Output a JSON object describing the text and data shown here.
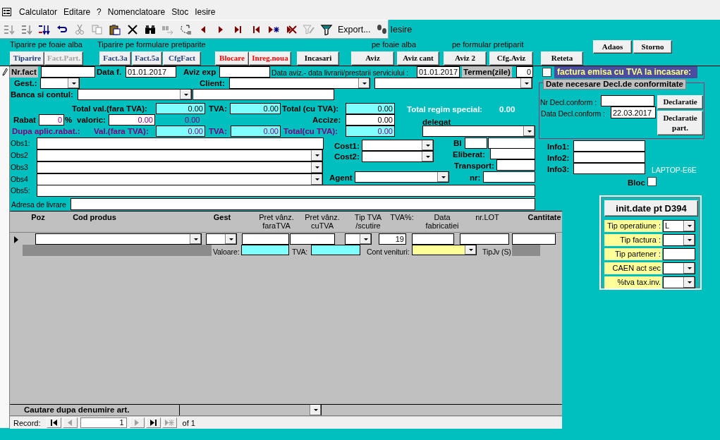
{
  "menu": [
    {
      "label": "Calculator"
    },
    {
      "label": "Editare"
    },
    {
      "label": "?"
    },
    {
      "label": "Nomenclatoare"
    },
    {
      "label": "Stoc"
    },
    {
      "label": "Iesire"
    }
  ],
  "toolbar": {
    "export_label": "Export...",
    "exit_label": "Iesire"
  },
  "button_bar": {
    "captions": [
      "Tiparire pe foaie alba",
      "Tiparire pe formulare pretiparite",
      "pe foaie alba",
      "pe formular pretiparit"
    ],
    "buttons": [
      {
        "label": "Tiparire",
        "color": "#1f3f7f",
        "disabled": false
      },
      {
        "label": "Fact.Part.",
        "disabled": true
      },
      {
        "label": "Fact.3a",
        "color": "#1f3f7f",
        "disabled": false
      },
      {
        "label": "Fact.5a",
        "color": "#1f3f7f",
        "disabled": false
      },
      {
        "label": "CfgFact",
        "color": "#1f3f7f",
        "disabled": false
      },
      {
        "label": "Blocare",
        "color": "#ff0000",
        "disabled": false
      },
      {
        "label": "Inreg.noua",
        "color": "#ff0000",
        "disabled": false
      },
      {
        "label": "Incasari",
        "color": "#000000",
        "disabled": false
      },
      {
        "label": "Aviz",
        "color": "#000000",
        "disabled": false
      },
      {
        "label": "Aviz cant",
        "color": "#000000",
        "disabled": false
      },
      {
        "label": "Aviz 2",
        "color": "#000000",
        "disabled": false
      },
      {
        "label": "Cfg.Aviz",
        "color": "#000000",
        "disabled": false
      },
      {
        "label": "Reteta",
        "color": "#000000",
        "disabled": false
      },
      {
        "label": "Adaos",
        "color": "#000000",
        "disabled": false
      },
      {
        "label": "Storno",
        "color": "#000000",
        "disabled": false
      }
    ]
  },
  "form": {
    "controls": [
      {
        "kind": "label",
        "text": "Nr.fact",
        "shaded": true
      },
      {
        "kind": "field"
      },
      {
        "kind": "label",
        "text": "Data f."
      },
      {
        "kind": "field",
        "value": "01.01.2017"
      },
      {
        "kind": "label",
        "text": "Aviz exp"
      },
      {
        "kind": "field"
      },
      {
        "kind": "caption",
        "text": "Data aviz.- data livrarii/prestarii serviciului :"
      },
      {
        "kind": "field",
        "value": "01.01.2017"
      },
      {
        "kind": "label",
        "text": "Termen(zile)",
        "shaded": true
      },
      {
        "kind": "field",
        "value": "0"
      },
      {
        "kind": "checkbox",
        "checked": false
      },
      {
        "kind": "banner",
        "text": "factura emisa cu TVA la incasare:"
      },
      {
        "kind": "label",
        "text": "Gest.:"
      },
      {
        "kind": "combo"
      },
      {
        "kind": "label",
        "text": "Client:"
      },
      {
        "kind": "combo"
      },
      {
        "kind": "combo"
      },
      {
        "kind": "label",
        "text": "Banca si contul:"
      },
      {
        "kind": "combo"
      },
      {
        "kind": "field"
      },
      {
        "kind": "label",
        "text": "Total val.(fara TVA):"
      },
      {
        "kind": "field",
        "value": "0.00",
        "readonly": true
      },
      {
        "kind": "label",
        "text": "TVA:"
      },
      {
        "kind": "field",
        "value": "0.00",
        "readonly": true
      },
      {
        "kind": "label",
        "text": "Total (cu TVA):"
      },
      {
        "kind": "field",
        "value": "0.00",
        "readonly": true
      },
      {
        "kind": "label",
        "text": "Total regim special:",
        "color": "#ffffff"
      },
      {
        "kind": "label",
        "text": "0.00",
        "color": "#ffffff"
      },
      {
        "kind": "label",
        "text": "Rabat"
      },
      {
        "kind": "field",
        "value": "0",
        "discounted": true
      },
      {
        "kind": "label",
        "text": "%"
      },
      {
        "kind": "label",
        "text": "valoric:"
      },
      {
        "kind": "field",
        "value": "0.00",
        "discounted": true
      },
      {
        "kind": "value",
        "text": "0.00",
        "discounted": true
      },
      {
        "kind": "label",
        "text": "Accize:"
      },
      {
        "kind": "field",
        "value": "0.00"
      },
      {
        "kind": "label",
        "text": "delegat"
      },
      {
        "kind": "label",
        "text": "Dupa aplic.rabat.:",
        "color": "#800080"
      },
      {
        "kind": "label",
        "text": "Val.(fara TVA):",
        "color": "#800080"
      },
      {
        "kind": "field",
        "value": "0.00",
        "readonly": true,
        "discounted": true
      },
      {
        "kind": "label",
        "text": "TVA:",
        "color": "#800080"
      },
      {
        "kind": "field",
        "value": "0.00",
        "readonly": true,
        "discounted": true
      },
      {
        "kind": "label",
        "text": "Total(cu TVA):",
        "color": "#800080"
      },
      {
        "kind": "field",
        "value": "0.00",
        "readonly": true,
        "discounted": true
      },
      {
        "kind": "combo"
      },
      {
        "kind": "caption",
        "text": "Obs1:"
      },
      {
        "kind": "field"
      },
      {
        "kind": "label",
        "text": "Cost1:"
      },
      {
        "kind": "combo"
      },
      {
        "kind": "label",
        "text": "BI"
      },
      {
        "kind": "field"
      },
      {
        "kind": "field"
      },
      {
        "kind": "caption",
        "text": "Obs2"
      },
      {
        "kind": "combo"
      },
      {
        "kind": "label",
        "text": "Cost2:"
      },
      {
        "kind": "combo"
      },
      {
        "kind": "label",
        "text": "Eliberat:"
      },
      {
        "kind": "field"
      },
      {
        "kind": "caption",
        "text": "Obs3"
      },
      {
        "kind": "combo"
      },
      {
        "kind": "label",
        "text": "Transport:"
      },
      {
        "kind": "field"
      },
      {
        "kind": "caption",
        "text": "Obs4"
      },
      {
        "kind": "combo"
      },
      {
        "kind": "label",
        "text": "Agent"
      },
      {
        "kind": "combo"
      },
      {
        "kind": "label",
        "text": "nr:"
      },
      {
        "kind": "field"
      },
      {
        "kind": "caption",
        "text": "Obs5:"
      },
      {
        "kind": "field"
      },
      {
        "kind": "caption",
        "text": "Adresa de livrare"
      },
      {
        "kind": "field"
      },
      {
        "kind": "group",
        "text": "Date necesare Decl.de conformitate"
      },
      {
        "kind": "caption",
        "text": "Nr Decl.conform :"
      },
      {
        "kind": "field"
      },
      {
        "kind": "button",
        "text": "Declaratie"
      },
      {
        "kind": "caption",
        "text": "Data Decl.conform :"
      },
      {
        "kind": "field",
        "value": "22.03.2017"
      },
      {
        "kind": "button",
        "text": "Declaratie part."
      },
      {
        "kind": "label",
        "text": "Info1:"
      },
      {
        "kind": "field"
      },
      {
        "kind": "label",
        "text": "Info2:"
      },
      {
        "kind": "field"
      },
      {
        "kind": "label",
        "text": "Info3:"
      },
      {
        "kind": "field"
      },
      {
        "kind": "caption",
        "text": "LAPTOP-E6E",
        "color": "#ffffff"
      },
      {
        "kind": "label",
        "text": "Bloc"
      },
      {
        "kind": "checkbox",
        "checked": false
      }
    ]
  },
  "d394": {
    "title": "init.date pt D394",
    "rows": [
      {
        "label": "Tip operatiune :",
        "kind": "combo",
        "value": "L"
      },
      {
        "label": "Tip factura :",
        "kind": "combo"
      },
      {
        "label": "Tip partener :",
        "kind": "field"
      },
      {
        "label": "CAEN act sec",
        "kind": "combo"
      },
      {
        "label": "%tva tax.inv.",
        "kind": "combo"
      }
    ]
  },
  "grid": {
    "columns": [
      {
        "label": "Poz",
        "bold": true
      },
      {
        "label": "Cod produs",
        "bold": true
      },
      {
        "label": "Gest",
        "bold": true
      },
      {
        "label": "Pret vânz. faraTVA",
        "bold": false
      },
      {
        "label": "Pret vânz. cuTVA",
        "bold": false
      },
      {
        "label": "Tip TVA /scutire",
        "bold": false
      },
      {
        "label": "TVA%:",
        "bold": false
      },
      {
        "label": "Data fabricatiei",
        "bold": false
      },
      {
        "label": "nr.LOT",
        "bold": false
      },
      {
        "label": "Cantitate",
        "bold": true
      }
    ],
    "row": [
      {
        "kind": "combo"
      },
      {
        "kind": "combo"
      },
      {
        "kind": "field"
      },
      {
        "kind": "field"
      },
      {
        "kind": "combo"
      },
      {
        "kind": "field",
        "value": "19"
      },
      {
        "kind": "field"
      },
      {
        "kind": "field"
      },
      {
        "kind": "field"
      }
    ],
    "subrow": [
      {
        "kind": "caption",
        "text": "Valoare:"
      },
      {
        "kind": "field",
        "readonly": true
      },
      {
        "kind": "caption",
        "text": "TVA:"
      },
      {
        "kind": "field",
        "readonly": true
      },
      {
        "kind": "caption",
        "text": "Cont venituri:"
      },
      {
        "kind": "combo",
        "color": "#ffff99"
      },
      {
        "kind": "caption",
        "text": "TipJv (S)"
      }
    ],
    "search_label": "Cautare dupa denumire art."
  },
  "record_nav": {
    "label": "Record:",
    "current": "1",
    "total_label": "of 1"
  }
}
